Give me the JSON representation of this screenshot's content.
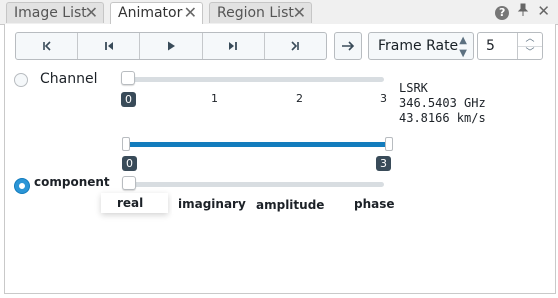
{
  "tabs": [
    {
      "label": "Image List",
      "active": false
    },
    {
      "label": "Animator",
      "active": true
    },
    {
      "label": "Region List",
      "active": false
    }
  ],
  "tab_close_glyph": "✕",
  "window_icons": [
    "help-icon",
    "pin-icon",
    "close-icon"
  ],
  "playback": {
    "buttons": [
      "first-frame-icon",
      "previous-frame-icon",
      "play-icon",
      "next-frame-icon",
      "last-frame-icon"
    ],
    "arrow_button_icon": "arrow-right-icon"
  },
  "frame_select": {
    "selected": "Frame Rate"
  },
  "frame_rate_input": {
    "value": "5"
  },
  "channel": {
    "label": "Channel",
    "selected": false,
    "value_badge": "0",
    "ticks": [
      "0",
      "1",
      "2",
      "3"
    ],
    "value": 0,
    "max": 3
  },
  "info": {
    "frame": "LSRK",
    "frequency": "346.5403 GHz",
    "velocity": "43.8166 km/s"
  },
  "range_slider": {
    "min_badge": "0",
    "max_badge": "3",
    "min": 0,
    "max": 3
  },
  "component": {
    "label": "component",
    "selected": true,
    "value": 0,
    "options": [
      "real",
      "imaginary",
      "amplitude",
      "phase"
    ]
  },
  "colors": {
    "accent": "#137cbd",
    "dark_badge": "#394b59"
  }
}
